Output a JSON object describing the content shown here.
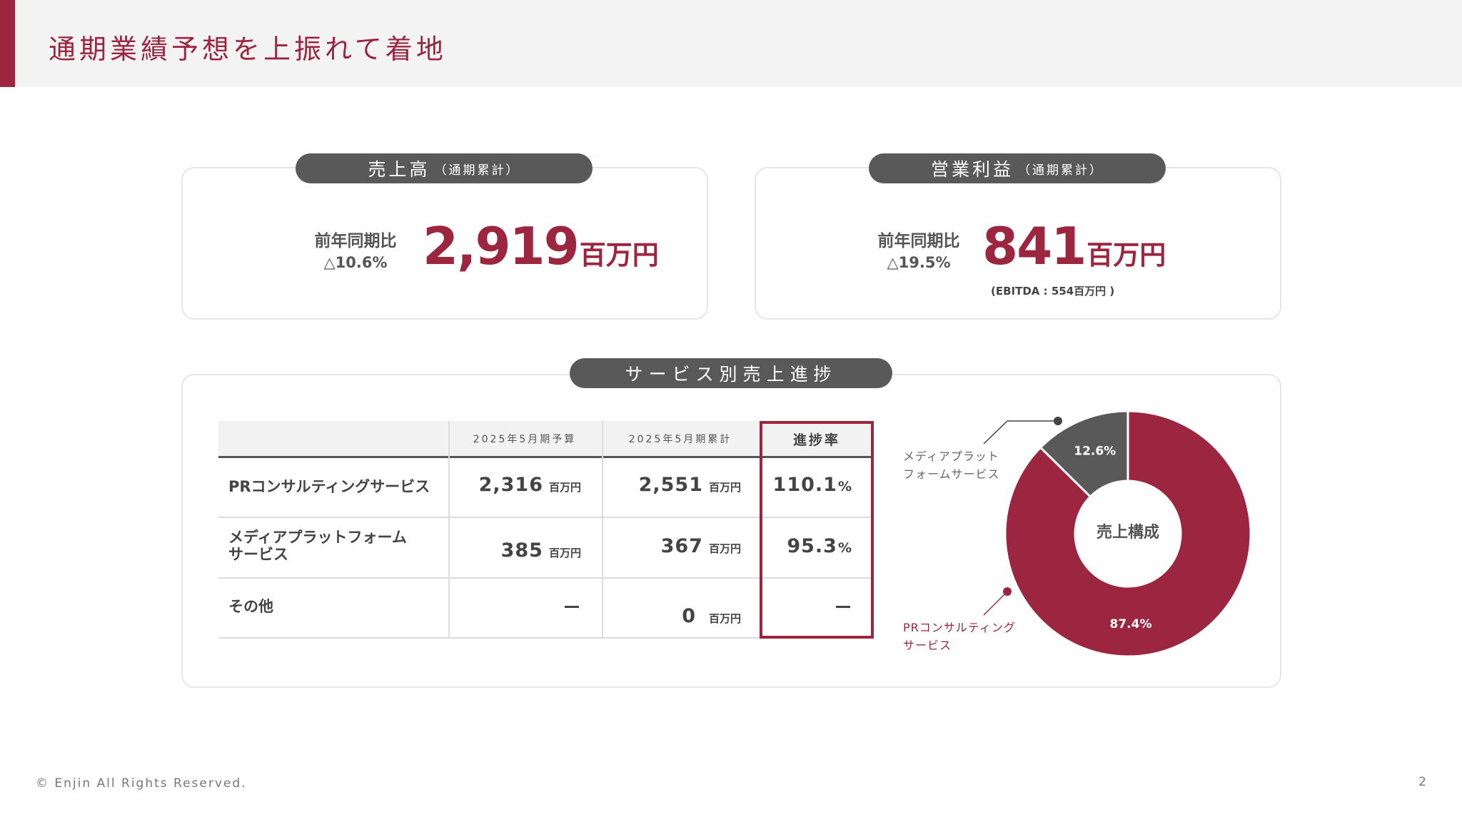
{
  "title": "通期業績予想を上振れて着地",
  "sales_card": {
    "pill_main": "売上高",
    "pill_sub": "（通期累計）",
    "yoy_label": "前年同期比",
    "yoy_value": "△10.6%",
    "value": "2,919",
    "unit": "百万円"
  },
  "profit_card": {
    "pill_main": "営業利益",
    "pill_sub": "（通期累計）",
    "yoy_label": "前年同期比",
    "yoy_value": "△19.5%",
    "value": "841",
    "unit": "百万円",
    "ebitda_note": "(EBITDA : 554百万円 )"
  },
  "service_section": {
    "pill": "サービス別売上進捗",
    "columns": [
      "",
      "2025年5月期予算",
      "2025年5月期累計",
      "進捗率"
    ],
    "rows": [
      {
        "label": "PRコンサルティングサービス",
        "budget": "2,316",
        "budget_unit": "百万円",
        "actual": "2,551",
        "actual_unit": "百万円",
        "rate": "110.1",
        "rate_unit": "%"
      },
      {
        "label": "メディアプラットフォーム\nサービス",
        "budget": "385",
        "budget_unit": "百万円",
        "actual": "367",
        "actual_unit": "百万円",
        "rate": "95.3",
        "rate_unit": "%"
      },
      {
        "label": "その他",
        "budget": "",
        "actual": "0",
        "actual_unit": "百万円",
        "rate": ""
      }
    ]
  },
  "chart_data": {
    "type": "pie",
    "title": "売上構成",
    "categories": [
      "PRコンサルティングサービス",
      "メディアプラットフォームサービス"
    ],
    "values": [
      87.4,
      12.6
    ],
    "value_labels": [
      "87.4%",
      "12.6%"
    ],
    "colors": [
      "#9c2640",
      "#595959"
    ],
    "donut": true
  },
  "callouts": {
    "media": "メディアプラット\nフォームサービス",
    "pr": "PRコンサルティング\nサービス"
  },
  "footer": "© Enjin All Rights Reserved.",
  "page_number": "2",
  "colors": {
    "accent": "#9c2640",
    "pill": "#595959",
    "header_bg": "#f3f3f3"
  }
}
